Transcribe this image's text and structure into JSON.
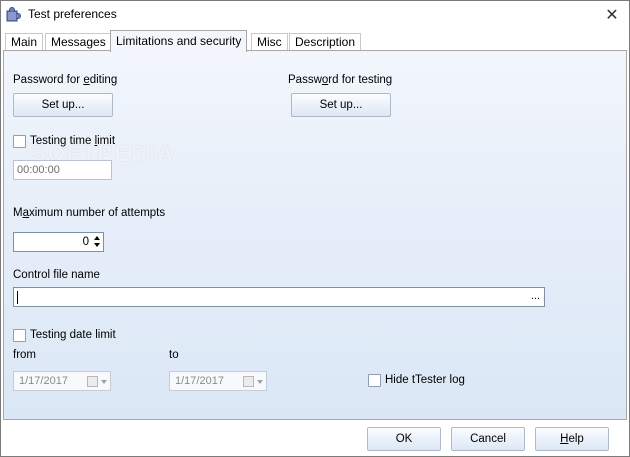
{
  "window": {
    "title": "Test preferences",
    "close_glyph": "✕",
    "icon": "puzzle-icon"
  },
  "tabs": [
    {
      "label": "Main",
      "active": false
    },
    {
      "label": "Messages",
      "active": false
    },
    {
      "label": "Limitations and security",
      "active": true
    },
    {
      "label": "Misc",
      "active": false
    },
    {
      "label": "Description",
      "active": false
    }
  ],
  "editing": {
    "label_pre": "Password for ",
    "label_key": "e",
    "label_post": "diting",
    "button": "Set up..."
  },
  "testing": {
    "label_pre": "Passw",
    "label_key": "o",
    "label_post": "rd for testing",
    "button": "Set up..."
  },
  "time_limit": {
    "label_pre": "Testing time ",
    "label_key": "l",
    "label_post": "imit",
    "checked": false,
    "value": "00:00:00"
  },
  "attempts": {
    "label_pre": "M",
    "label_key": "a",
    "label_post": "ximum number of attempts",
    "value": "0"
  },
  "control_file": {
    "label": "Control file name",
    "value": "",
    "browse": "..."
  },
  "date_limit": {
    "label": "Testing date limit",
    "checked": false,
    "from_label": "from",
    "to_label": "to",
    "from_value": "1/17/2017",
    "to_value": "1/17/2017"
  },
  "hide_log": {
    "label": "Hide tTester log",
    "checked": false
  },
  "footer": {
    "ok": "OK",
    "cancel": "Cancel",
    "help_key": "H",
    "help_rest": "elp"
  },
  "watermark": "SOFTPEDIA"
}
